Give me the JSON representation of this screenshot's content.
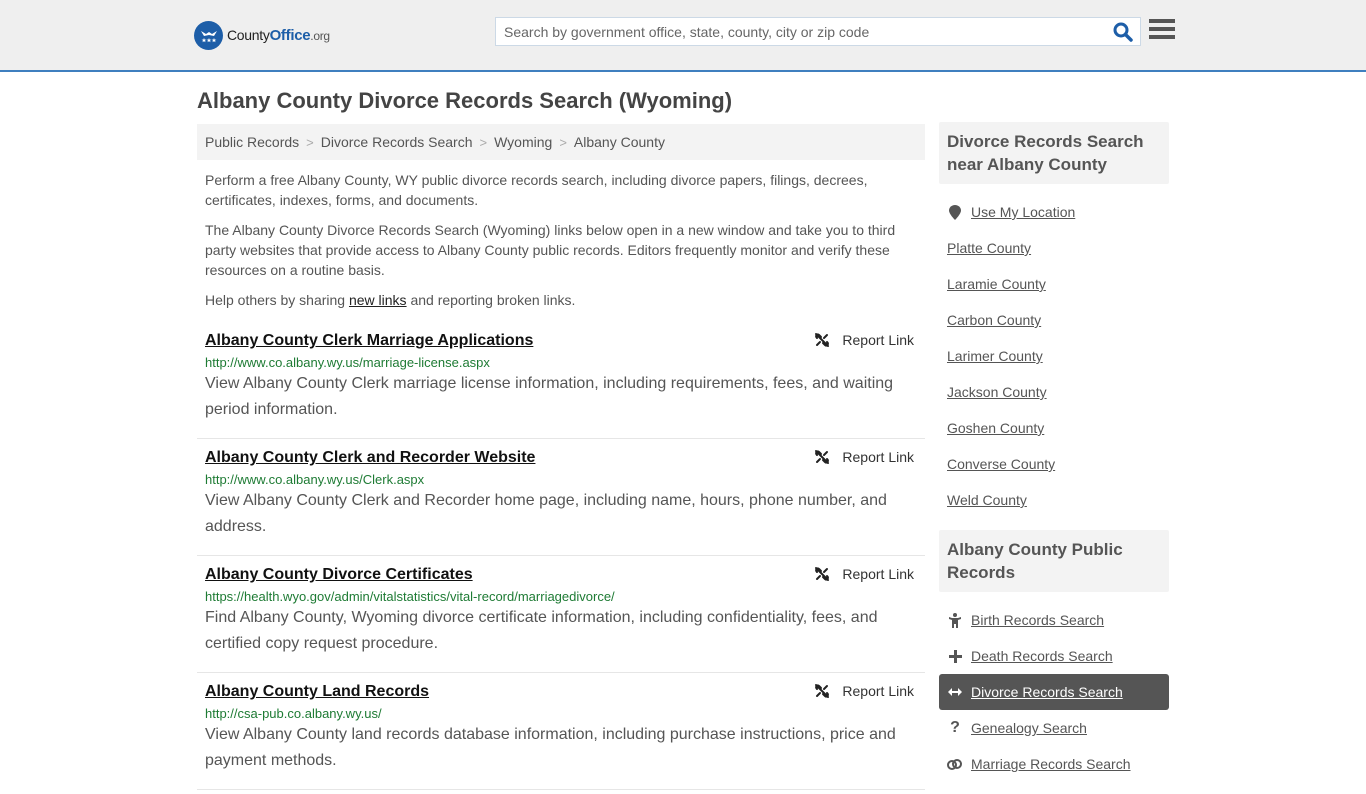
{
  "header": {
    "logo_county": "County",
    "logo_office": "Office",
    "logo_org": ".org",
    "search_placeholder": "Search by government office, state, county, city or zip code",
    "search_value": "",
    "colors": {
      "brand": "#1d5ea8",
      "accent_border": "#3f7fbf"
    }
  },
  "page": {
    "title": "Albany County Divorce Records Search (Wyoming)",
    "breadcrumb": [
      "Public Records",
      "Divorce Records Search",
      "Wyoming",
      "Albany County"
    ],
    "breadcrumb_separator": ">",
    "intro": {
      "p1": "Perform a free Albany County, WY public divorce records search, including divorce papers, filings, decrees, certificates, indexes, forms, and documents.",
      "p2": "The Albany County Divorce Records Search (Wyoming) links below open in a new window and take you to third party websites that provide access to Albany County public records. Editors frequently monitor and verify these resources on a routine basis.",
      "p3_before": "Help others by sharing ",
      "p3_link": "new links",
      "p3_after": " and reporting broken links."
    }
  },
  "links": [
    {
      "title": "Albany County Clerk Marriage Applications",
      "url": "http://www.co.albany.wy.us/marriage-license.aspx",
      "description": "View Albany County Clerk marriage license information, including requirements, fees, and waiting period information.",
      "report_label": "Report Link"
    },
    {
      "title": "Albany County Clerk and Recorder Website",
      "url": "http://www.co.albany.wy.us/Clerk.aspx",
      "description": "View Albany County Clerk and Recorder home page, including name, hours, phone number, and address.",
      "report_label": "Report Link"
    },
    {
      "title": "Albany County Divorce Certificates",
      "url": "https://health.wyo.gov/admin/vitalstatistics/vital-record/marriagedivorce/",
      "description": "Find Albany County, Wyoming divorce certificate information, including confidentiality, fees, and certified copy request procedure.",
      "report_label": "Report Link"
    },
    {
      "title": "Albany County Land Records",
      "url": "http://csa-pub.co.albany.wy.us/",
      "description": "View Albany County land records database information, including purchase instructions, price and payment methods.",
      "report_label": "Report Link"
    }
  ],
  "sidebar": {
    "nearby": {
      "heading": "Divorce Records Search near Albany County",
      "use_location": {
        "label": "Use My Location",
        "icon": "map-marker-icon"
      },
      "counties": [
        "Platte County",
        "Laramie County",
        "Carbon County",
        "Larimer County",
        "Jackson County",
        "Goshen County",
        "Converse County",
        "Weld County"
      ]
    },
    "public_records": {
      "heading": "Albany County Public Records",
      "items": [
        {
          "label": "Birth Records Search",
          "icon": "child-icon",
          "glyph": "Ὣ8",
          "active": false
        },
        {
          "label": "Death Records Search",
          "icon": "plus-icon",
          "glyph": "+",
          "active": false
        },
        {
          "label": "Divorce Records Search",
          "icon": "arrows-horizontal-icon",
          "glyph": "↔",
          "active": true
        },
        {
          "label": "Genealogy Search",
          "icon": "question-icon",
          "glyph": "?",
          "active": false
        },
        {
          "label": "Marriage Records Search",
          "icon": "rings-icon",
          "glyph": "⚭",
          "active": false
        }
      ]
    }
  }
}
